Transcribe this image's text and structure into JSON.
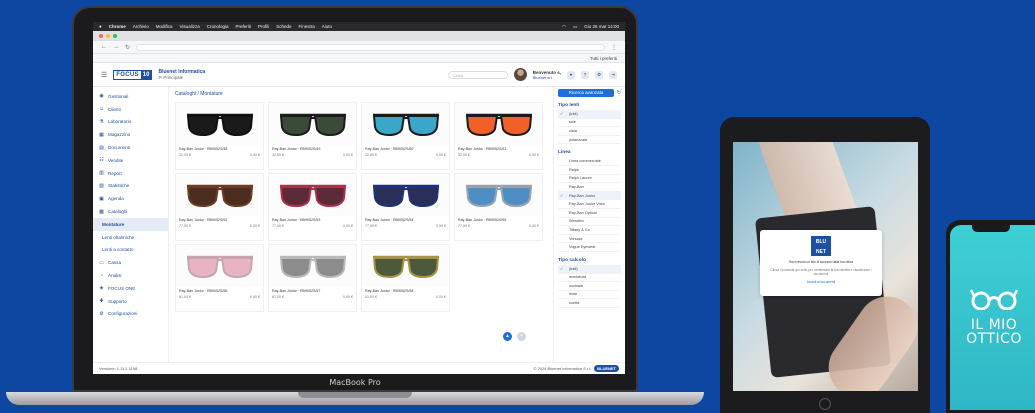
{
  "colors": {
    "background": "#0d47a1",
    "brand": "#1e4fa1",
    "accent": "#1e6fd9",
    "phone": "#35c4cf"
  },
  "laptop": {
    "brand": "MacBook Pro",
    "menubar": {
      "items": [
        "Chrome",
        "Archivio",
        "Modifica",
        "Visualizza",
        "Cronologia",
        "Preferiti",
        "Profili",
        "Schede",
        "Finestra",
        "Aiuto"
      ],
      "clock": "Gio 26 mar 14:00"
    },
    "browser": {
      "bookmark": "Tutti i preferiti"
    },
    "app": {
      "logo_a": "FOCUS",
      "logo_b": "10",
      "company_name": "Bluenet Informatica",
      "company_sub": "P. Principale",
      "search_placeholder": "Cerca",
      "user_greeting": "Benvenuto s,",
      "user_name": "Bluenet srl",
      "sidebar": [
        {
          "label": "Gestionali",
          "icon": "dashboard-icon"
        },
        {
          "label": "Clienti",
          "icon": "users-icon"
        },
        {
          "label": "Laboratorio",
          "icon": "lab-icon"
        },
        {
          "label": "Magazzino",
          "icon": "warehouse-icon"
        },
        {
          "label": "Documenti",
          "icon": "document-icon"
        },
        {
          "label": "Vendite",
          "icon": "sales-icon"
        },
        {
          "label": "Report",
          "icon": "report-icon"
        },
        {
          "label": "Statistiche",
          "icon": "stats-icon"
        },
        {
          "label": "Agenda",
          "icon": "calendar-icon"
        },
        {
          "label": "Cataloghi",
          "icon": "catalog-icon"
        },
        {
          "label": "Montature",
          "icon": "",
          "sub": true,
          "active": true
        },
        {
          "label": "Lenti oftalmiche",
          "icon": "",
          "sub": true
        },
        {
          "label": "Lenti a contatto",
          "icon": "",
          "sub": true
        },
        {
          "label": "Cassa",
          "icon": "cash-icon"
        },
        {
          "label": "Analisi",
          "icon": "analysis-icon"
        },
        {
          "label": "FOCUS ONE",
          "icon": "focus-one-icon"
        },
        {
          "label": "Supporto",
          "icon": "support-icon"
        },
        {
          "label": "Configurazioni",
          "icon": "settings-icon"
        }
      ],
      "breadcrumb": "Cataloghi / Montature",
      "products": [
        {
          "title": "Ray-Ban Junior · RB9052S/48",
          "price": "32,00 €",
          "qty": "0,00 €",
          "lens": "#1a1a1a",
          "frame": "#111"
        },
        {
          "title": "Ray-Ban Junior · RB9052S/49",
          "price": "32,00 €",
          "qty": "0,00 €",
          "lens": "#3c4a3a",
          "frame": "#1c1c1c"
        },
        {
          "title": "Ray-Ban Junior · RB9052S/50",
          "price": "32,00 €",
          "qty": "0,00 €",
          "lens": "#3aa6c9",
          "frame": "#1b1b1b"
        },
        {
          "title": "Ray-Ban Junior · RB9052S/51",
          "price": "32,00 €",
          "qty": "0,00 €",
          "lens": "#f2602a",
          "frame": "#1b1b1b"
        },
        {
          "title": "Ray-Ban Junior · RB9052S/52",
          "price": "77,00 €",
          "qty": "0,00 €",
          "lens": "#4b2e1f",
          "frame": "#6a3a22"
        },
        {
          "title": "Ray-Ban Junior · RB9052S/53",
          "price": "77,00 €",
          "qty": "0,00 €",
          "lens": "#5b2b3a",
          "frame": "#b0304a"
        },
        {
          "title": "Ray-Ban Junior · RB9052S/54",
          "price": "77,00 €",
          "qty": "0,00 €",
          "lens": "#2a2f5a",
          "frame": "#20307a"
        },
        {
          "title": "Ray-Ban Junior · RB9052S/55",
          "price": "77,00 €",
          "qty": "0,00 €",
          "lens": "#4d8fc4",
          "frame": "#9aa2ad"
        },
        {
          "title": "Ray-Ban Junior · RB9052S/56",
          "price": "81,00 €",
          "qty": "0,00 €",
          "lens": "#e8b4c4",
          "frame": "#c8a5ae"
        },
        {
          "title": "Ray-Ban Junior · RB9052S/57",
          "price": "81,00 €",
          "qty": "0,00 €",
          "lens": "#8c8c8c",
          "frame": "#b9b9b9"
        },
        {
          "title": "Ray-Ban Junior · RB9052S/58",
          "price": "81,00 €",
          "qty": "0,00 €",
          "lens": "#4c5a3a",
          "frame": "#a6944a"
        }
      ],
      "filters": {
        "search_button": "Ricerca avanzata",
        "group1_title": "Tipo lenti",
        "group1": [
          {
            "label": "(tutti)",
            "sel": true
          },
          {
            "label": "sole"
          },
          {
            "label": "vista"
          },
          {
            "label": "polarizzate"
          }
        ],
        "group2_title": "Linea",
        "group2": [
          {
            "label": "Linea commerciale"
          },
          {
            "label": "Ralph"
          },
          {
            "label": "Ralph Lauren"
          },
          {
            "label": "Ray-Ban"
          },
          {
            "label": "Ray-Ban Junior",
            "sel": true
          },
          {
            "label": "Ray-Ban Junior Vista"
          },
          {
            "label": "Ray-Ban Optical"
          },
          {
            "label": "Sferoflex"
          },
          {
            "label": "Tiffany & Co."
          },
          {
            "label": "Versace"
          },
          {
            "label": "Vogue Eyewear"
          }
        ],
        "group3_title": "Tipo calcolo",
        "group3": [
          {
            "label": "(tutti)",
            "sel": true
          },
          {
            "label": "montatura"
          },
          {
            "label": "occhiale"
          },
          {
            "label": "lente"
          },
          {
            "label": "ricetta"
          }
        ]
      },
      "footer_version": "Versione: 1.11.1.1198",
      "footer_copy": "© 2024 Bluenet Informatica S.r.l.",
      "footer_brand": "BLUENET"
    }
  },
  "tablet": {
    "modal_logo_line1": "BLU",
    "modal_logo_line2": "NET",
    "modal_title": "Hai ricevuto un link di accesso dalla tua ottica",
    "modal_text": "Clicca il pulsante qui sotto per confermare la tua identità e visualizzare i documenti",
    "modal_button": "Accedi ai documenti"
  },
  "phone": {
    "app_line1": "IL MIO",
    "app_line2": "OTTICO"
  }
}
